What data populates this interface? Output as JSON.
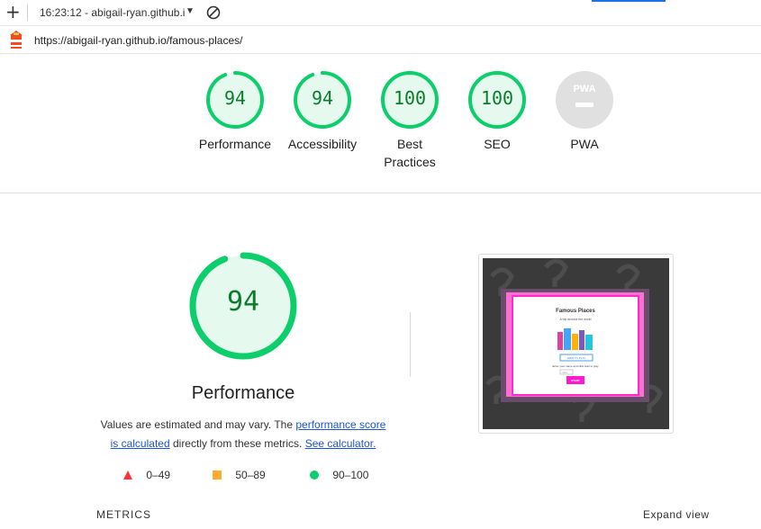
{
  "toolbar": {
    "timeline_label": "16:23:12 - abigail-ryan.github.i",
    "plus_glyph": "+",
    "caret_glyph": "▼"
  },
  "urlbar": {
    "url": "https://abigail-ryan.github.io/famous-places/"
  },
  "categories": [
    {
      "label": "Performance",
      "score": "94",
      "fraction": 0.94
    },
    {
      "label": "Accessibility",
      "score": "94",
      "fraction": 0.94
    },
    {
      "label_line1": "Best",
      "label_line2": "Practices",
      "score": "100",
      "fraction": 1.0
    },
    {
      "label": "SEO",
      "score": "100",
      "fraction": 1.0
    },
    {
      "label": "PWA",
      "badge": "PWA"
    }
  ],
  "performance": {
    "score": "94",
    "fraction": 0.94,
    "title": "Performance",
    "note_prefix": "Values are estimated and may vary. The ",
    "link_score_a": "performance score",
    "link_score_b": "is calculated",
    "note_middle": " directly from these metrics. ",
    "link_calc": "See calculator."
  },
  "legend": [
    {
      "range": "0–49",
      "color": "#ff3333"
    },
    {
      "range": "50–89",
      "color": "#ffaa33"
    },
    {
      "range": "90–100",
      "color": "#0cce6b"
    }
  ],
  "thumbnail": {
    "heading": "Famous Places",
    "tagline": "A trip around the world",
    "button_how": "HOW TO PLAY",
    "prompt": "Enter your name and click start to play",
    "input_placeholder": "name",
    "start": "START"
  },
  "footer": {
    "metrics": "METRICS",
    "expand": "Expand view"
  },
  "colors": {
    "pass": "#0cce6b",
    "pass_text": "#0a7c2c",
    "pass_bg": "#e5f9ee",
    "pwa_gray": "#e0e0e0",
    "link": "#1a55d8"
  }
}
